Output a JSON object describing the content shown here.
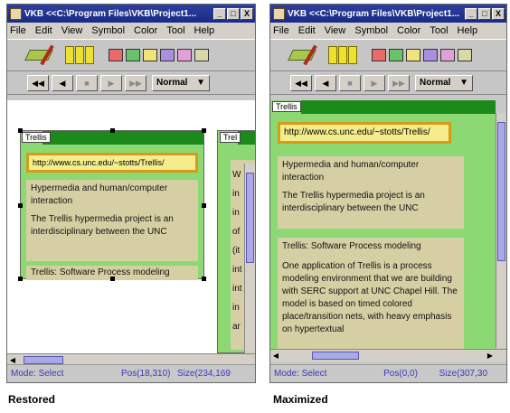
{
  "windows": [
    {
      "id": "restored",
      "title": "VKB <<C:\\Program Files\\VKB\\Project1...",
      "window_buttons": [
        "_",
        "□",
        "X"
      ],
      "menu": [
        "File",
        "Edit",
        "View",
        "Symbol",
        "Color",
        "Tool",
        "Help"
      ],
      "playback": [
        "◀◀",
        "◀",
        "■",
        "▶",
        "▶▶"
      ],
      "speed": "Normal",
      "status": {
        "mode": "Mode: Select",
        "pos": "Pos(18,310)",
        "size": "Size(234,169"
      },
      "caption": "Restored"
    },
    {
      "id": "maximized",
      "title": "VKB <<C:\\Program Files\\VKB\\Project1...",
      "window_buttons": [
        "_",
        "□",
        "X"
      ],
      "menu": [
        "File",
        "Edit",
        "View",
        "Symbol",
        "Color",
        "Tool",
        "Help"
      ],
      "playback": [
        "◀◀",
        "◀",
        "■",
        "▶",
        "▶▶"
      ],
      "speed": "Normal",
      "status": {
        "mode": "Mode: Select",
        "pos": "Pos(0,0)",
        "size": "Size(307,30"
      },
      "caption": "Maximized"
    }
  ],
  "swatch_colors": [
    "#e96a6a",
    "#6ac36a",
    "#f2e27a",
    "#a98fe0",
    "#e0a0d8",
    "#d8d8a8"
  ],
  "doc": {
    "tab_label": "Trellis",
    "tab_label_short": "Trel",
    "url": "http://www.cs.unc.edu/~stotts/Trellis/",
    "url_short": "http://www.cs.unc.edu/~stotts/Trellis/",
    "para1": "Hypermedia and human/computer interaction",
    "para2": "The Trellis hypermedia project is an",
    "para2_clip": "interdisciplinary between the UNC",
    "para3_title": "Trellis: Software Process modeling",
    "para3_body": "One application of Trellis is a process modeling environment that we are building with SERC support at UNC Chapel Hill. The model is based on timed colored place/transition nets, with heavy emphasis on hypertextual",
    "side_fragments": [
      "W",
      "in",
      "in",
      "of",
      "(it",
      "int",
      "int",
      "in",
      "ar"
    ]
  }
}
